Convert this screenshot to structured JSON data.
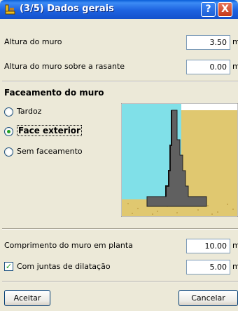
{
  "window": {
    "title": "(3/5) Dados gerais",
    "help_glyph": "?",
    "close_glyph": "X",
    "icon": "wall-app-icon"
  },
  "fields": [
    {
      "label": "Altura do muro",
      "value": "3.50",
      "unit": "m"
    },
    {
      "label": "Altura do muro sobre a rasante",
      "value": "0.00",
      "unit": "m"
    }
  ],
  "facing": {
    "title": "Faceamento do muro",
    "options": [
      {
        "label": "Tardoz",
        "selected": false
      },
      {
        "label": "Face exterior",
        "selected": true
      },
      {
        "label": "Sem faceamento",
        "selected": false
      }
    ]
  },
  "preview_colors": {
    "sky": "#80e0e8",
    "soil": "#e0c870",
    "wall": "#606060"
  },
  "length": {
    "label": "Comprimento do muro em planta",
    "value": "10.00",
    "unit": "m"
  },
  "joints": {
    "label": "Com juntas de dilatação",
    "checked": true,
    "value": "5.00",
    "unit": "m"
  },
  "buttons": {
    "accept": "Aceitar",
    "cancel": "Cancelar"
  }
}
